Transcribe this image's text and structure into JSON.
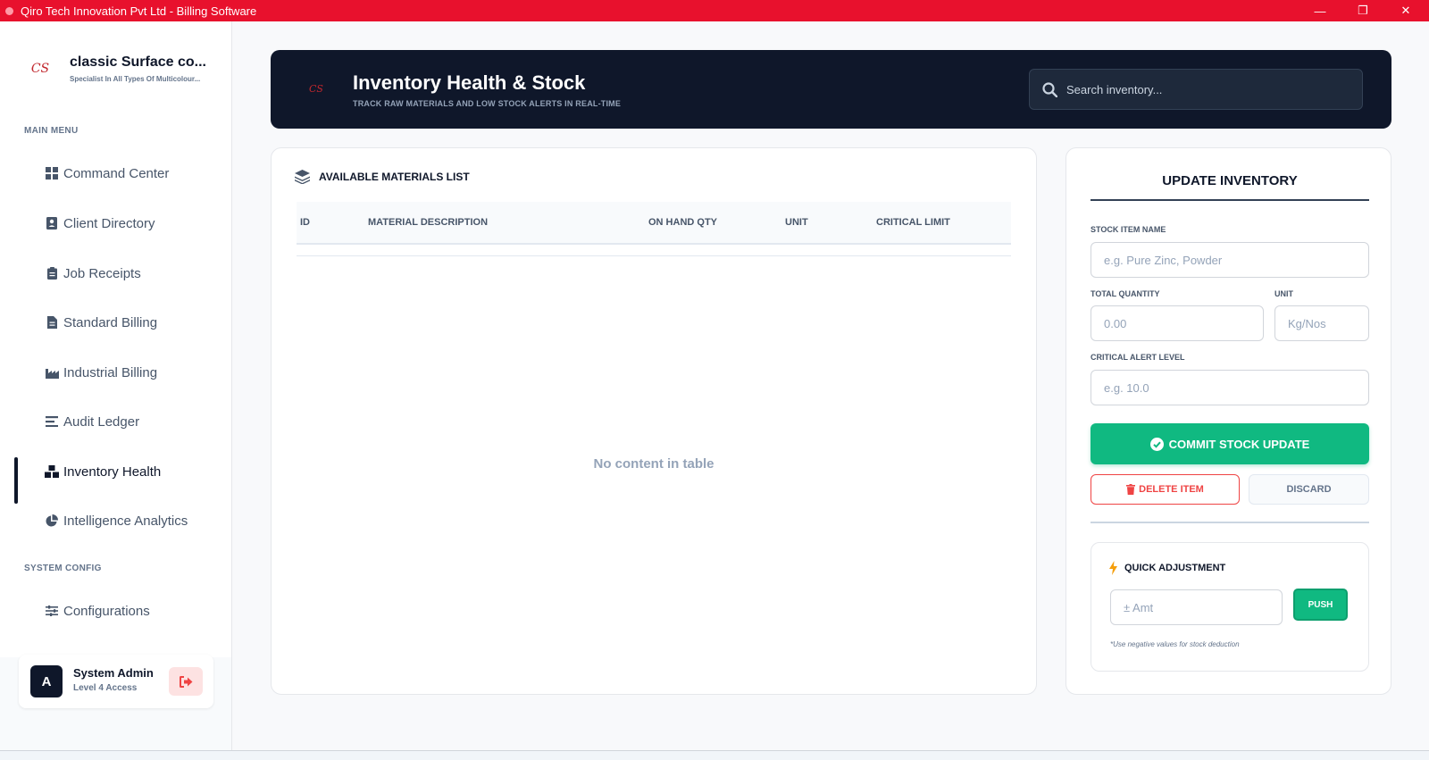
{
  "window": {
    "title": "Qiro Tech Innovation Pvt Ltd - Billing Software",
    "minimize": "—",
    "maximize": "❐",
    "close": "✕"
  },
  "brand": {
    "name": "classic Surface co...",
    "tagline": "Specialist In All Types Of Multicolour...",
    "logo_text": "CS"
  },
  "sidebar": {
    "main_menu_label": "MAIN MENU",
    "system_config_label": "SYSTEM CONFIG",
    "items": [
      {
        "label": "Command Center",
        "icon": "grid-icon"
      },
      {
        "label": "Client Directory",
        "icon": "contact-card-icon"
      },
      {
        "label": "Job Receipts",
        "icon": "clipboard-icon"
      },
      {
        "label": "Standard Billing",
        "icon": "document-icon"
      },
      {
        "label": "Industrial Billing",
        "icon": "industry-icon"
      },
      {
        "label": "Audit Ledger",
        "icon": "lines-icon"
      },
      {
        "label": "Inventory Health",
        "icon": "boxes-icon",
        "active": true
      },
      {
        "label": "Intelligence Analytics",
        "icon": "pie-chart-icon"
      }
    ],
    "config_items": [
      {
        "label": "Configurations",
        "icon": "sliders-icon"
      }
    ]
  },
  "user": {
    "initial": "A",
    "name": "System Admin",
    "role": "Level 4 Access"
  },
  "header": {
    "title": "Inventory Health & Stock",
    "subtitle": "TRACK RAW MATERIALS AND LOW STOCK ALERTS IN REAL-TIME",
    "search_placeholder": "Search inventory...",
    "logo_text": "CS"
  },
  "materials": {
    "title": "AVAILABLE MATERIALS LIST",
    "columns": [
      "ID",
      "MATERIAL DESCRIPTION",
      "ON HAND QTY",
      "UNIT",
      "CRITICAL LIMIT"
    ],
    "rows": [],
    "empty_text": "No content in table"
  },
  "update": {
    "title": "UPDATE INVENTORY",
    "stock_item_label": "STOCK ITEM NAME",
    "stock_item_placeholder": "e.g. Pure Zinc, Powder",
    "total_qty_label": "TOTAL QUANTITY",
    "total_qty_placeholder": "0.00",
    "unit_label": "UNIT",
    "unit_placeholder": "Kg/Nos",
    "critical_label": "CRITICAL ALERT LEVEL",
    "critical_placeholder": "e.g. 10.0",
    "commit_label": "COMMIT STOCK UPDATE",
    "delete_label": "DELETE ITEM",
    "discard_label": "DISCARD"
  },
  "quick": {
    "title": "QUICK ADJUSTMENT",
    "amount_placeholder": "± Amt",
    "push_label": "PUSH",
    "hint": "*Use negative values for stock deduction"
  },
  "colors": {
    "titlebar": "#e8112d",
    "header_bg": "#0f172a",
    "accent_green": "#10b981",
    "danger": "#ef4444"
  }
}
